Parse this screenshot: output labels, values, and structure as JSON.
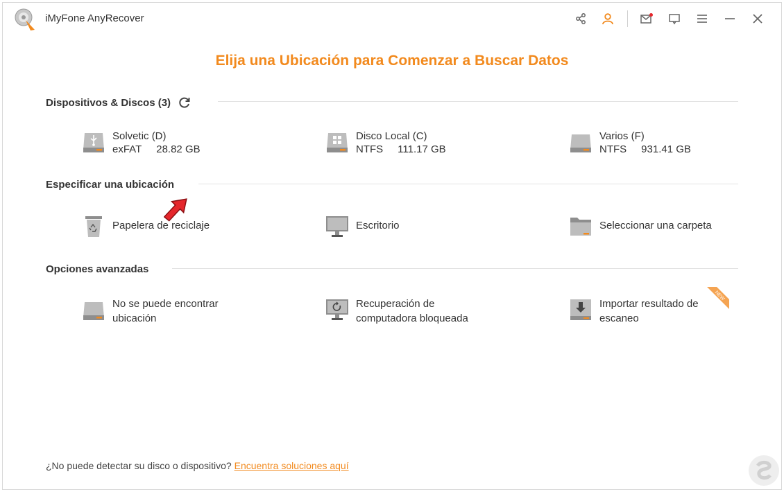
{
  "app": {
    "title": "iMyFone AnyRecover"
  },
  "titlebar_icons": [
    "share-icon",
    "user-icon",
    "mail-icon",
    "feedback-icon",
    "menu-icon",
    "minimize-icon",
    "close-icon"
  ],
  "main_title": "Elija una Ubicación para Comenzar a Buscar Datos",
  "devices": {
    "heading": "Dispositivos & Discos (3)",
    "items": [
      {
        "name": "Solvetic (D)",
        "fs": "exFAT",
        "size": "28.82 GB",
        "icon": "usb-drive-icon"
      },
      {
        "name": "Disco Local (C)",
        "fs": "NTFS",
        "size": "111.17 GB",
        "icon": "windows-drive-icon"
      },
      {
        "name": "Varios (F)",
        "fs": "NTFS",
        "size": "931.41 GB",
        "icon": "hard-drive-icon"
      }
    ]
  },
  "locations": {
    "heading": "Especificar una ubicación",
    "items": [
      {
        "label": "Papelera de reciclaje",
        "icon": "recycle-bin-icon"
      },
      {
        "label": "Escritorio",
        "icon": "desktop-icon"
      },
      {
        "label": "Seleccionar una carpeta",
        "icon": "folder-icon"
      }
    ]
  },
  "advanced": {
    "heading": "Opciones avanzadas",
    "items": [
      {
        "line1": "No se puede encontrar",
        "line2": "ubicación",
        "icon": "lost-drive-icon"
      },
      {
        "line1": "Recuperación de",
        "line2": "computadora bloqueada",
        "icon": "crashed-computer-icon"
      },
      {
        "line1": "Importar resultado de",
        "line2": "escaneo",
        "icon": "import-icon",
        "badge": "NEW"
      }
    ]
  },
  "footer": {
    "question": "¿No puede detectar su disco o dispositivo?",
    "link": "Encuentra soluciones aquí"
  },
  "colors": {
    "accent": "#f28a1e",
    "arrow": "#e5262b"
  }
}
